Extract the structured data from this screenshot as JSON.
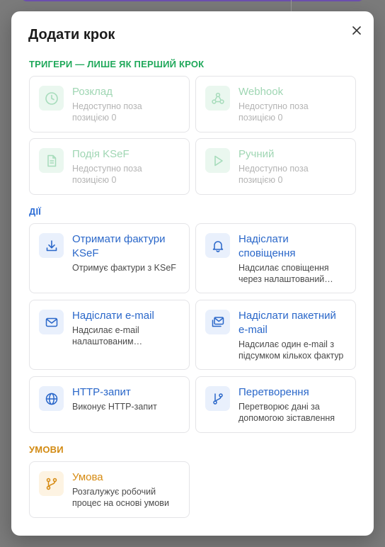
{
  "modal": {
    "title": "Додати крок"
  },
  "sections": {
    "triggers": "ТРИГЕРИ — ЛИШЕ ЯК ПЕРШИЙ КРОК",
    "actions": "ДІЇ",
    "conditions": "УМОВИ"
  },
  "triggers": [
    {
      "title": "Розклад",
      "desc": "Недоступно поза позицією 0",
      "icon": "clock-icon"
    },
    {
      "title": "Webhook",
      "desc": "Недоступно поза позицією 0",
      "icon": "webhook-icon"
    },
    {
      "title": "Подія KSeF",
      "desc": "Недоступно поза позицією 0",
      "icon": "document-icon"
    },
    {
      "title": "Ручний",
      "desc": "Недоступно поза позицією 0",
      "icon": "play-icon"
    }
  ],
  "actions": [
    {
      "title": "Отримати фактури KSeF",
      "desc": "Отримує фактури з KSeF",
      "icon": "download-icon"
    },
    {
      "title": "Надіслати сповіщення",
      "desc": "Надсилає сповіщення через налаштований канал",
      "icon": "bell-icon"
    },
    {
      "title": "Надіслати e-mail",
      "desc": "Надсилає e-mail налаштованим одержувачам",
      "icon": "mail-icon"
    },
    {
      "title": "Надіслати пакетний e-mail",
      "desc": "Надсилає один e-mail з підсумком кількох фактур",
      "icon": "mail-stack-icon"
    },
    {
      "title": "HTTP-запит",
      "desc": "Виконує HTTP-запит",
      "icon": "globe-icon"
    },
    {
      "title": "Перетворення",
      "desc": "Перетворює дані за допомогою зіставлення",
      "icon": "branch-icon"
    }
  ],
  "conditions": [
    {
      "title": "Умова",
      "desc": "Розгалужує робочий процес на основі умови",
      "icon": "fork-icon"
    }
  ],
  "colors": {
    "trigger_accent": "#1fa85a",
    "action_accent": "#2a67c9",
    "condition_accent": "#d68a10"
  }
}
